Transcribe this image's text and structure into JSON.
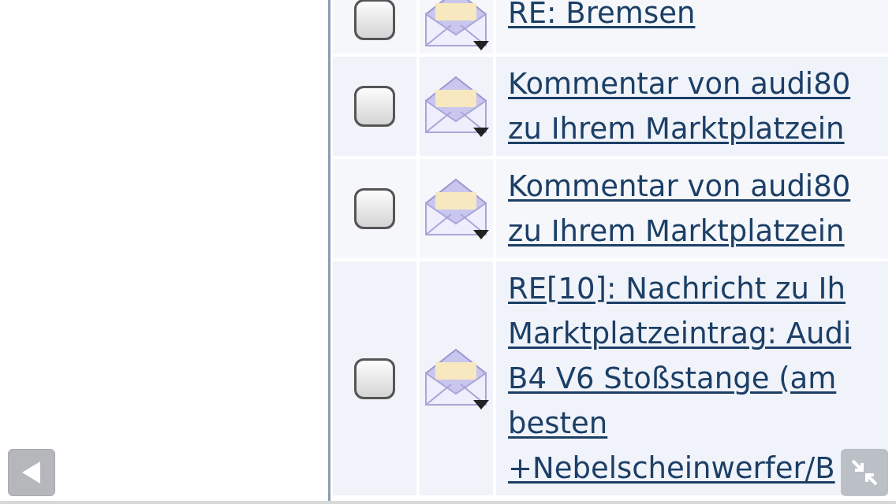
{
  "messages": [
    {
      "checked": false,
      "subject_lines": [
        "RE: Bremsen"
      ]
    },
    {
      "checked": false,
      "subject_lines": [
        "Kommentar von audi80",
        "zu Ihrem Marktplatzein"
      ]
    },
    {
      "checked": false,
      "subject_lines": [
        "Kommentar von audi80",
        "zu Ihrem Marktplatzein"
      ]
    },
    {
      "checked": false,
      "subject_lines": [
        "RE[10]: Nachricht zu Ih",
        "Marktplatzeintrag: Audi",
        "B4 V6 Stoßstange (am",
        "besten",
        "+Nebelscheinwerfer/B"
      ]
    }
  ]
}
